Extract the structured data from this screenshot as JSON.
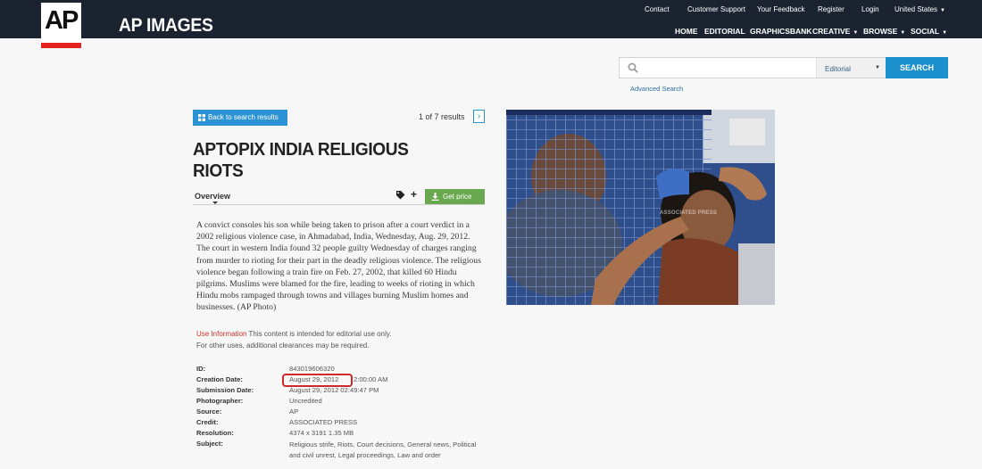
{
  "header": {
    "logo_text": "AP",
    "brand": "AP IMAGES",
    "util_links": [
      "Contact",
      "Customer Support",
      "Your Feedback",
      "Register",
      "Login",
      "United States"
    ],
    "nav": [
      "HOME",
      "EDITORIAL",
      "GRAPHICSBANK",
      "CREATIVE",
      "BROWSE",
      "SOCIAL"
    ]
  },
  "search": {
    "placeholder": "",
    "category": "Editorial",
    "button": "SEARCH",
    "advanced": "Advanced Search"
  },
  "detail": {
    "back_label": "Back to search results",
    "results_text": "1 of 7 results",
    "next_glyph": "›",
    "title": "APTOPIX INDIA RELIGIOUS RIOTS",
    "tab": "Overview",
    "price_label": "Get price",
    "plus_glyph": "+",
    "caption": "A convict consoles his son while being taken to prison after a court verdict in a 2002 religious violence case, in Ahmadabad, India, Wednesday, Aug. 29, 2012. The court in western India found 32 people guilty Wednesday of charges ranging from murder to rioting for their part in the deadly religious violence. The religious violence began following a train fire on Feb. 27, 2002, that killed 60 Hindu pilgrims. Muslims were blamed for the fire, leading to weeks of rioting in which Hindu mobs rampaged through towns and villages burning Muslim homes and businesses. (AP Photo)",
    "use_link": "Use Information",
    "use_text_1": "This content is intended for editorial use only.",
    "use_text_2": "For other uses, additional clearances may be required.",
    "watermark": "ASSOCIATED PRESS"
  },
  "meta": {
    "id_label": "ID:",
    "id": "843019606320",
    "creation_label": "Creation Date:",
    "creation_date": "August 29, 2012",
    "creation_time": "2:00:00 AM",
    "submission_label": "Submission Date:",
    "submission": "August 29, 2012 02:49:47 PM",
    "photographer_label": "Photographer:",
    "photographer": "Uncredited",
    "source_label": "Source:",
    "source": "AP",
    "credit_label": "Credit:",
    "credit": "ASSOCIATED PRESS",
    "resolution_label": "Resolution:",
    "resolution": "4374 x 3191 1.35 MB",
    "subject_label": "Subject:",
    "subject": "Religious strife, Riots, Court decisions, General news, Political and civil unrest, Legal proceedings, Law and order"
  },
  "colors": {
    "header_bg": "#1b2230",
    "logo_red": "#e4211e",
    "search_button": "#1c8fcd",
    "back_button": "#2b92d3",
    "price_button": "#6aa84f",
    "highlight": "#cf2a2a"
  },
  "icons": [
    "search-icon",
    "grid-icon",
    "tag-icon",
    "plus-icon",
    "download-icon",
    "chevron-right-icon",
    "caret-down-icon"
  ]
}
